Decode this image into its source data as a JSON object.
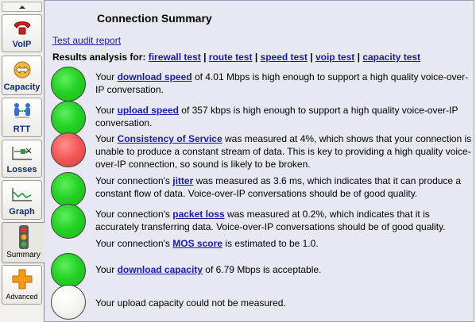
{
  "sidebar": {
    "tabs": [
      {
        "id": "voip",
        "label": "VoIP",
        "icon": "phone-icon"
      },
      {
        "id": "capacity",
        "label": "Capacity",
        "icon": "capacity-arrows-icon"
      },
      {
        "id": "rtt",
        "label": "RTT",
        "icon": "network-people-icon"
      },
      {
        "id": "losses",
        "label": "Losses",
        "icon": "losses-chart-icon"
      },
      {
        "id": "graph",
        "label": "Graph",
        "icon": "line-graph-icon"
      },
      {
        "id": "summary",
        "label": "Summary",
        "icon": "traffic-light-icon"
      },
      {
        "id": "advanced",
        "label": "Advanced",
        "icon": "plus-icon"
      }
    ]
  },
  "main": {
    "title": "Connection Summary",
    "audit_link": "Test audit report",
    "results_prefix": "Results analysis for:",
    "tests": [
      "firewall test",
      "route test",
      "speed test",
      "voip test",
      "capacity test"
    ],
    "separator": "|",
    "results": [
      {
        "status": "green",
        "pre": "Your ",
        "keyword": "download speed",
        "post": " of 4.01 Mbps is high enough to support a high quality voice-over-IP conversation."
      },
      {
        "status": "green",
        "pre": "Your ",
        "keyword": "upload speed",
        "post": " of 357 kbps is high enough to support a high quality voice-over-IP conversation."
      },
      {
        "status": "red",
        "pre": "Your ",
        "keyword": "Consistency of Service",
        "post": " was measured at 4%, which shows that your connection is unable to produce a constant stream of data. This is key to providing a high quality voice-over-IP connection, so sound is likely to be broken."
      },
      {
        "status": "green",
        "pre": "Your connection's ",
        "keyword": "jitter",
        "post": " was measured as 3.6 ms, which indicates that it can produce a constant flow of data. Voice-over-IP conversations should be of good quality."
      },
      {
        "status": "green",
        "pre": "Your connection's ",
        "keyword": "packet loss",
        "post": " was measured at 0.2%, which indicates that it is accurately transferring data. Voice-over-IP conversations should be of good quality."
      },
      {
        "status": "none",
        "pre": "Your connection's ",
        "keyword": "MOS score",
        "post": " is estimated to be 1.0."
      },
      {
        "status": "green",
        "pre": "Your ",
        "keyword": "download capacity",
        "post": " of 6.79 Mbps is acceptable."
      },
      {
        "status": "white",
        "pre": "Your upload capacity could not be measured.",
        "keyword": "",
        "post": ""
      }
    ]
  },
  "colors": {
    "panel_bg": "#e8e8f2",
    "link": "#1a1aa6",
    "green": "#27d227",
    "red": "#f35656",
    "white": "#f4f4f0"
  }
}
